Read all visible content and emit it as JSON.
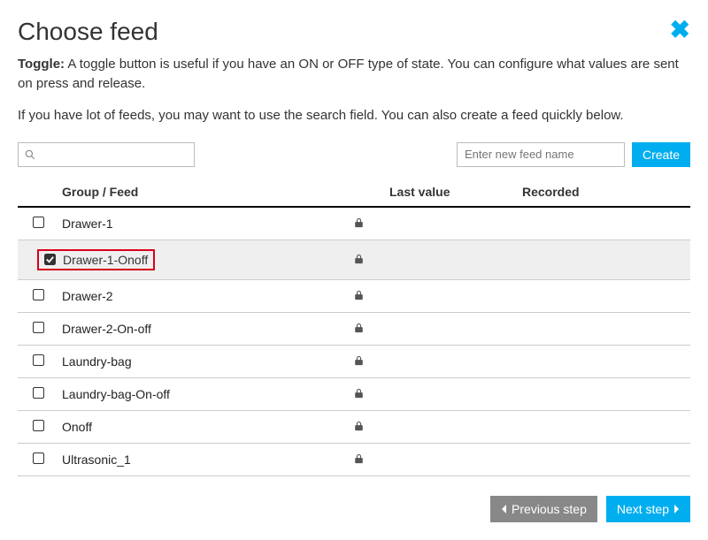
{
  "title": "Choose feed",
  "toggle_label": "Toggle:",
  "description": " A toggle button is useful if you have an ON or OFF type of state. You can configure what values are sent on press and release.",
  "hint": "If you have lot of feeds, you may want to use the search field. You can also create a feed quickly below.",
  "search": {
    "placeholder": ""
  },
  "new_feed": {
    "placeholder": "Enter new feed name"
  },
  "create_label": "Create",
  "columns": {
    "group_feed": "Group / Feed",
    "last_value": "Last value",
    "recorded": "Recorded"
  },
  "feeds": [
    {
      "name": "Drawer-1",
      "checked": false,
      "selected": false,
      "highlighted": false,
      "last_value": "",
      "recorded": ""
    },
    {
      "name": "Drawer-1-Onoff",
      "checked": true,
      "selected": true,
      "highlighted": true,
      "last_value": "",
      "recorded": ""
    },
    {
      "name": "Drawer-2",
      "checked": false,
      "selected": false,
      "highlighted": false,
      "last_value": "",
      "recorded": ""
    },
    {
      "name": "Drawer-2-On-off",
      "checked": false,
      "selected": false,
      "highlighted": false,
      "last_value": "",
      "recorded": ""
    },
    {
      "name": "Laundry-bag",
      "checked": false,
      "selected": false,
      "highlighted": false,
      "last_value": "",
      "recorded": ""
    },
    {
      "name": "Laundry-bag-On-off",
      "checked": false,
      "selected": false,
      "highlighted": false,
      "last_value": "",
      "recorded": ""
    },
    {
      "name": "Onoff",
      "checked": false,
      "selected": false,
      "highlighted": false,
      "last_value": "",
      "recorded": ""
    },
    {
      "name": "Ultrasonic_1",
      "checked": false,
      "selected": false,
      "highlighted": false,
      "last_value": "",
      "recorded": ""
    }
  ],
  "buttons": {
    "previous": "Previous step",
    "next": "Next step"
  },
  "colors": {
    "accent": "#00aeef",
    "secondary": "#888888",
    "highlight_border": "#d9001b"
  }
}
